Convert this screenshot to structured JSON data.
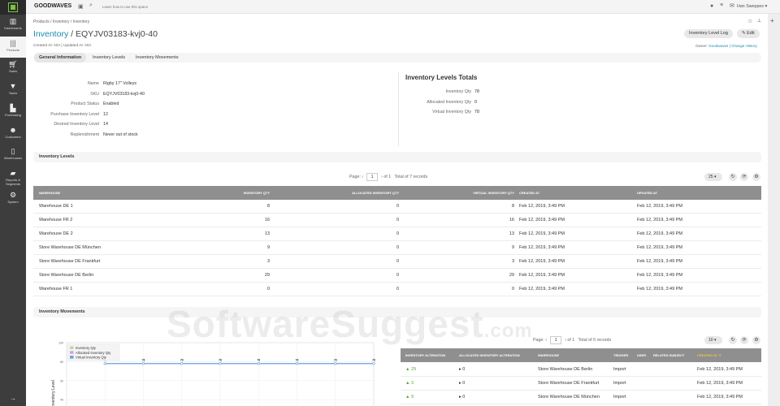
{
  "sidebar": {
    "items": [
      {
        "label": "Dashboards",
        "icon": "bar-chart-icon"
      },
      {
        "label": "Products",
        "icon": "barcode-icon"
      },
      {
        "label": "Sales",
        "icon": "cart-icon"
      },
      {
        "label": "Taxes",
        "icon": "filter-icon"
      },
      {
        "label": "Purchasing",
        "icon": "factory-icon"
      },
      {
        "label": "Customers",
        "icon": "users-icon"
      },
      {
        "label": "Warehouses",
        "icon": "warehouse-icon"
      },
      {
        "label": "Reports & Segments",
        "icon": "folder-icon"
      },
      {
        "label": "System",
        "icon": "gear-icon"
      }
    ]
  },
  "topbar": {
    "brand": "GOODWAVES",
    "help": "Learn how to use this space",
    "user": "Han Sweppes"
  },
  "header": {
    "breadcrumb": "Products / Inventory / Inventory",
    "title_link": "Inventory",
    "title_sep": " / ",
    "title": "EQYJV03183-kvj0-40",
    "meta": "Created At: N/A  |  Updated At: N/A",
    "log_button": "Inventory Level Log",
    "edit_button": "Edit",
    "owner_label": "Owner:",
    "owner": "Goodwaves",
    "change_history": "Change History"
  },
  "tabs": [
    "General Information",
    "Inventory Levels",
    "Inventory Movements"
  ],
  "info": [
    {
      "label": "Name",
      "value": "Rigby 17\" Volleys"
    },
    {
      "label": "SKU",
      "value": "EQYJV03183-kvj0-40"
    },
    {
      "label": "Product Status",
      "value": "Enabled"
    },
    {
      "label": "Purchase Inventory Level",
      "value": "12"
    },
    {
      "label": "Desired Inventory Level",
      "value": "14"
    },
    {
      "label": "Replenishment",
      "value": "Never out of stock"
    }
  ],
  "totals": {
    "title": "Inventory Levels Totals",
    "rows": [
      {
        "label": "Inventory Qty",
        "value": "78"
      },
      {
        "label": "Allocated Inventory Qty",
        "value": "0"
      },
      {
        "label": "Virtual Inventory Qty",
        "value": "78"
      }
    ]
  },
  "levels": {
    "title": "Inventory Levels",
    "pager": {
      "page_label": "Page:",
      "page": "1",
      "of": "of 1",
      "total": "Total of 7 records",
      "per_page": "25"
    },
    "columns": [
      "WAREHOUSE",
      "INVENTORY QTY",
      "ALLOCATED INVENTORY QTY",
      "VIRTUAL INVENTORY QTY",
      "CREATED AT",
      "UPDATED AT"
    ],
    "rows": [
      [
        "Warehouse DE 1",
        "8",
        "0",
        "8",
        "Feb 12, 2019, 3:49 PM",
        "Feb 12, 2019, 3:49 PM"
      ],
      [
        "Warehouse FR 2",
        "16",
        "0",
        "16",
        "Feb 12, 2019, 3:49 PM",
        "Feb 12, 2019, 3:49 PM"
      ],
      [
        "Warehouse DE 2",
        "13",
        "0",
        "13",
        "Feb 12, 2019, 3:49 PM",
        "Feb 12, 2019, 3:49 PM"
      ],
      [
        "Store Warehouse DE München",
        "9",
        "0",
        "9",
        "Feb 12, 2019, 3:49 PM",
        "Feb 12, 2019, 3:49 PM"
      ],
      [
        "Store Warehouse DE Frankfurt",
        "3",
        "0",
        "3",
        "Feb 12, 2019, 3:49 PM",
        "Feb 12, 2019, 3:49 PM"
      ],
      [
        "Store Warehouse DE Berlin",
        "29",
        "0",
        "29",
        "Feb 12, 2019, 3:49 PM",
        "Feb 12, 2019, 3:49 PM"
      ],
      [
        "Warehouse FR 1",
        "0",
        "0",
        "0",
        "Feb 12, 2019, 3:49 PM",
        "Feb 12, 2019, 3:49 PM"
      ]
    ]
  },
  "movements": {
    "title": "Inventory Movements",
    "pager": {
      "page_label": "Page:",
      "page": "1",
      "of": "of 1",
      "total": "Total of 6 records",
      "per_page": "10"
    },
    "columns": [
      "INVENTORY ALTERATION",
      "ALLOCATED INVENTORY ALTERATION",
      "WAREHOUSE",
      "TRIGGER",
      "USER",
      "RELATED SUBJECT",
      "CREATED AT ▼"
    ],
    "rows": [
      [
        "▲ 29",
        "▸ 0",
        "Store Warehouse DE Berlin",
        "Import",
        "",
        "",
        "Feb 12, 2019, 3:49 PM"
      ],
      [
        "▲ 3",
        "▸ 0",
        "Store Warehouse DE Frankfurt",
        "Import",
        "",
        "",
        "Feb 12, 2019, 3:49 PM"
      ],
      [
        "▲ 9",
        "▸ 0",
        "Store Warehouse DE München",
        "Import",
        "",
        "",
        "Feb 12, 2019, 3:49 PM"
      ]
    ]
  },
  "chart_data": {
    "type": "line",
    "ylabel": "Inventory Level",
    "ylim": [
      0,
      100
    ],
    "yticks": [
      "100",
      "80",
      "60",
      "40"
    ],
    "legend": [
      "Inventory Qty",
      "Allocated Inventory Qty",
      "Virtual Inventory Qty"
    ],
    "legend_colors": [
      "#b6dba4",
      "#c9a3e6",
      "#6a9fe0"
    ],
    "legend_position": "top-left",
    "series": [
      {
        "name": "Virtual Inventory Qty",
        "values": [
          78,
          78,
          78,
          78,
          78,
          78,
          78,
          78
        ]
      }
    ]
  },
  "watermark": {
    "main": "SoftwareSuggest",
    ".com": ".com"
  }
}
